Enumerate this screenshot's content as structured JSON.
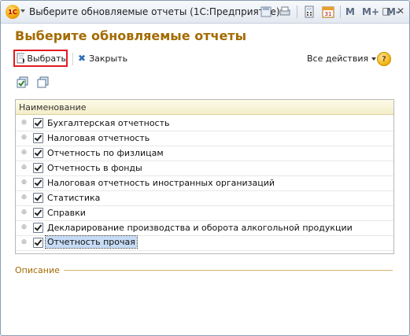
{
  "window": {
    "title": "Выберите обновляемые отчеты  (1С:Предприятие)",
    "logo_text": "1С",
    "m_buttons": [
      "M",
      "M+",
      "M-"
    ],
    "controls": {
      "minimize": "─",
      "restore": "□",
      "close": "✕"
    }
  },
  "form": {
    "heading": "Выберите обновляемые отчеты"
  },
  "toolbar": {
    "select_label": "Выбрать",
    "close_label": "Закрыть",
    "all_actions_label": "Все действия",
    "help_label": "?"
  },
  "tree": {
    "column_header": "Наименование",
    "expander": "⊕",
    "items": [
      {
        "label": "Бухгалтерская отчетность",
        "checked": true
      },
      {
        "label": "Налоговая отчетность",
        "checked": true
      },
      {
        "label": "Отчетность по физлицам",
        "checked": true
      },
      {
        "label": "Отчетность в фонды",
        "checked": true
      },
      {
        "label": "Налоговая отчетность иностранных организаций",
        "checked": true
      },
      {
        "label": "Статистика",
        "checked": true
      },
      {
        "label": "Справки",
        "checked": true
      },
      {
        "label": "Декларирование производства и оборота алкогольной продукции",
        "checked": true
      },
      {
        "label": "Отчетность прочая",
        "checked": true,
        "selected": true
      }
    ]
  },
  "description": {
    "label": "Описание"
  },
  "colors": {
    "accent": "#a36b00",
    "highlight_border": "#e11b22",
    "selection": "#c6dcf6"
  }
}
